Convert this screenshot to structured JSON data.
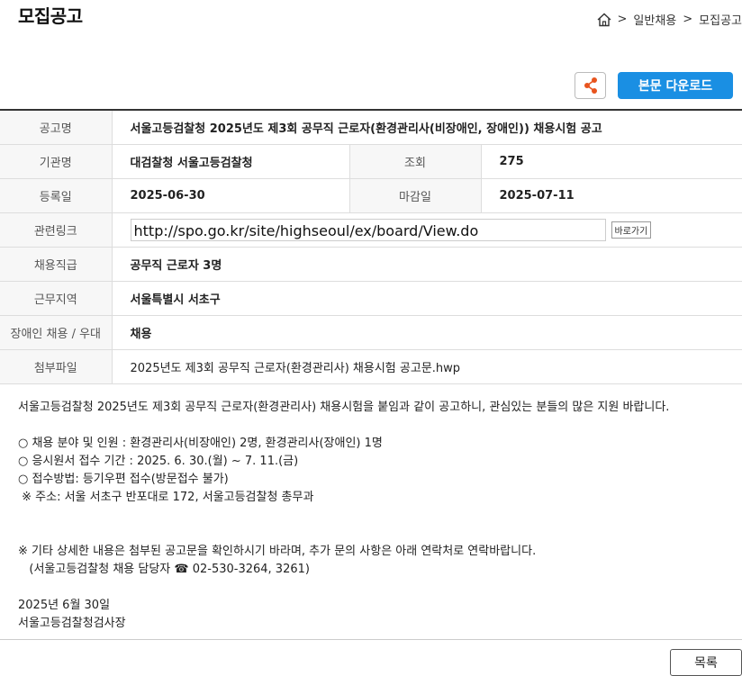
{
  "header": {
    "title": "모집공고",
    "breadcrumb": [
      ">",
      "일반채용",
      ">",
      "모집공고"
    ]
  },
  "toolbar": {
    "share_icon": "share-icon",
    "download_label": "본문 다운로드"
  },
  "info": {
    "title_label": "공고명",
    "title_value": "서울고등검찰청 2025년도 제3회 공무직 근로자(환경관리사(비장애인, 장애인)) 채용시험 공고",
    "org_label": "기관명",
    "org_value": "대검찰청 서울고등검찰청",
    "views_label": "조회",
    "views_value": "275",
    "reg_label": "등록일",
    "reg_value": "2025-06-30",
    "deadline_label": "마감일",
    "deadline_value": "2025-07-11",
    "link_label": "관련링크",
    "link_value": "http://spo.go.kr/site/highseoul/ex/board/View.do",
    "link_go": "바로가기",
    "position_label": "채용직급",
    "position_value": "공무직 근로자 3명",
    "region_label": "근무지역",
    "region_value": "서울특별시 서초구",
    "disabled_label": "장애인 채용 / 우대",
    "disabled_value": "채용",
    "attach_label": "첨부파일",
    "attach_value": "2025년도 제3회 공무직 근로자(환경관리사) 채용시험 공고문.hwp"
  },
  "body": {
    "intro": "서울고등검찰청 2025년도 제3회 공무직 근로자(환경관리사) 채용시험을 붙임과 같이 공고하니, 관심있는 분들의 많은 지원 바랍니다.",
    "line1": "○ 채용 분야 및 인원 : 환경관리사(비장애인) 2명, 환경관리사(장애인) 1명",
    "line2": "○ 응시원서 접수 기간 : 2025. 6. 30.(월) ~ 7. 11.(금)",
    "line3": "○ 접수방법: 등기우편 접수(방문접수 불가)",
    "line4": " ※ 주소: 서울 서초구 반포대로 172, 서울고등검찰청 총무과",
    "note1": "※ 기타 상세한 내용은 첨부된 공고문을 확인하시기 바라며, 추가 문의 사항은 아래 연락처로 연락바랍니다.",
    "note2": "   (서울고등검찰청 채용 담당자 ☎ 02-530-3264, 3261)",
    "date": "2025년 6월 30일",
    "signer": "서울고등검찰청검사장"
  },
  "footer": {
    "list_label": "목록"
  }
}
